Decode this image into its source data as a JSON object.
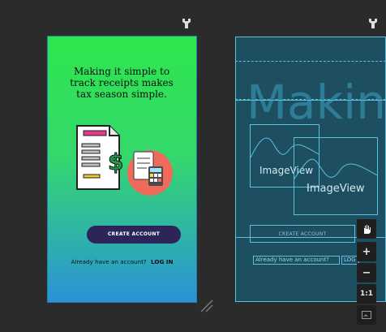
{
  "design": {
    "headline": "Making it simple to track receipts makes tax season simple.",
    "create_button": "CREATE ACCOUNT",
    "have_account_text": "Already have an account?",
    "login_link": "LOG IN",
    "colors": {
      "gradient_top": "#2ee64c",
      "gradient_bottom": "#2a92d6",
      "button": "#2d2559"
    }
  },
  "blueprint": {
    "title_text": "Makin",
    "image_view_1": "ImageView",
    "image_view_2": "ImageView",
    "create_button": "CREATE ACCOUNT",
    "have_account_text": "Already have an account?",
    "login_link": "LOG",
    "colors": {
      "background": "#1e4f60",
      "outline": "#58c1df"
    }
  },
  "toolbar": {
    "pan_icon": "hand-icon",
    "zoom_in": "+",
    "zoom_out": "−",
    "actual_size": "1:1",
    "fit_icon": "fit-screen-icon"
  }
}
